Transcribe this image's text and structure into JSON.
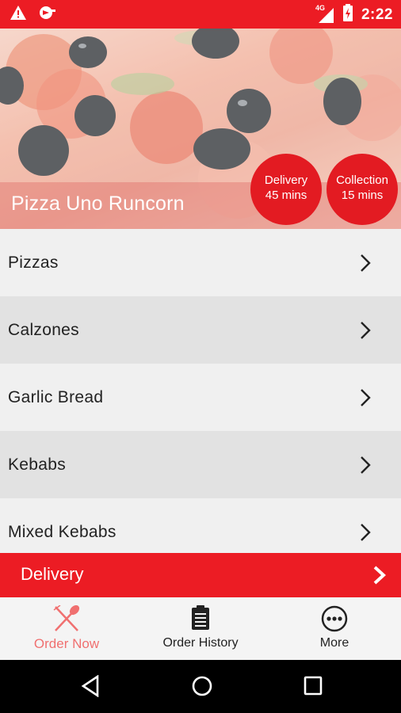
{
  "status_bar": {
    "network": "4G",
    "time": "2:22",
    "icons": [
      "warning-icon",
      "cast-icon",
      "signal-icon",
      "battery-charging-icon"
    ]
  },
  "hero": {
    "title": "Pizza Uno Runcorn",
    "delivery_badge": {
      "line1": "Delivery",
      "line2": "45 mins"
    },
    "collection_badge": {
      "line1": "Collection",
      "line2": "15 mins"
    }
  },
  "menu": {
    "items": [
      {
        "label": "Pizzas"
      },
      {
        "label": "Calzones"
      },
      {
        "label": "Garlic Bread"
      },
      {
        "label": "Kebabs"
      },
      {
        "label": "Mixed Kebabs"
      }
    ]
  },
  "delivery_bar": {
    "label": "Delivery"
  },
  "tabs": {
    "order_now": "Order Now",
    "order_history": "Order History",
    "more": "More"
  },
  "colors": {
    "accent": "#ec1c24",
    "badge": "#e31b22",
    "active_tab": "#f07070"
  }
}
